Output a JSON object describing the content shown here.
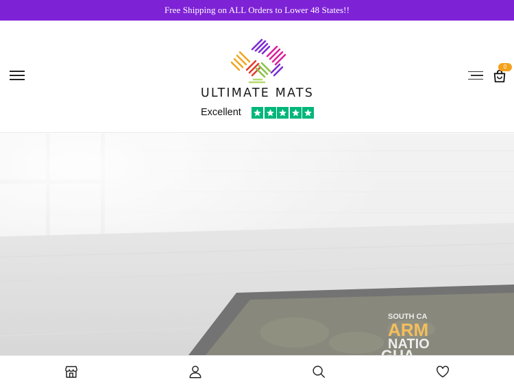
{
  "announcement": {
    "text": "Free Shipping on ALL Orders to Lower 48 States!!"
  },
  "header": {
    "brand": "ULTIMATE MATS",
    "rating_label": "Excellent",
    "rating_stars": 5,
    "cart_count": "0",
    "colors": {
      "accent": "#7e22d6",
      "trust_green": "#00b67a",
      "badge": "#f4a21d"
    }
  },
  "icons": {
    "menu_left": "hamburger-menu-icon",
    "menu_right": "menu-lines-icon",
    "cart": "shopping-bag-icon",
    "nav": [
      "store-icon",
      "account-icon",
      "search-icon",
      "wishlist-heart-icon"
    ]
  },
  "hero": {
    "mat_text_lines": [
      "SOUTH CA",
      "ARM",
      "NATIO",
      "GUA"
    ]
  }
}
